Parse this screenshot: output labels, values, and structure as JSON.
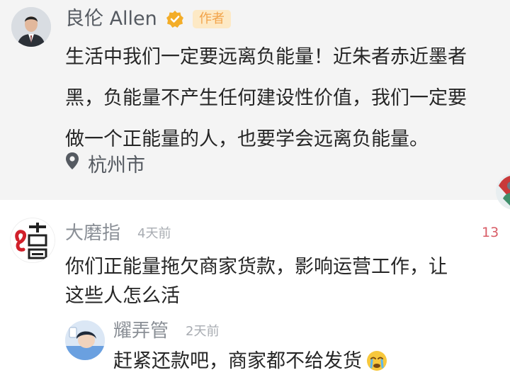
{
  "colors": {
    "post_background": "#f4f4f4",
    "author_badge_background": "#fde9c5",
    "author_badge_text": "#f2a34a",
    "verified_badge": "#f3ad28",
    "likes_count": "#d85c66",
    "muted_text": "#8a8f96"
  },
  "post": {
    "author_name": "良伦 Allen",
    "author_badge": "作者",
    "verified_icon": "verified-badge-icon",
    "text_lines": [
      "生活中我们一定要远离负能量！近朱者赤近墨者",
      "黑，负能量不产生任何建设性价值，我们一定要",
      "做一个正能量的人，也要学会远离负能量。"
    ],
    "location_icon": "location-pin-icon",
    "location": "杭州市"
  },
  "comment": {
    "avatar_icon": "damozhi-logo-avatar",
    "author_name": "大磨指",
    "time": "4天前",
    "likes": "13",
    "text_lines": [
      "你们正能量拖欠商家货款，影响运营工作，让",
      "这些人怎么活"
    ]
  },
  "reply": {
    "author_name": "耀弄管",
    "time": "2天前",
    "text": "赶紧还款吧，商家都不给发货",
    "emoji_icon": "crying-face-emoji"
  }
}
